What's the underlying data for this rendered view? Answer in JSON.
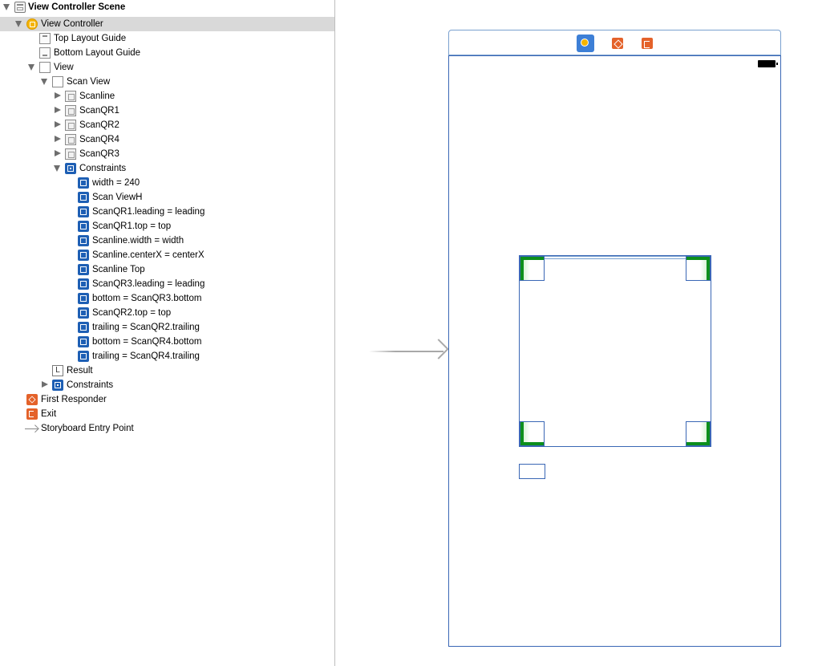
{
  "outline": {
    "items": [
      {
        "label": "View Controller Scene",
        "icon": "scene-icon"
      },
      {
        "label": "View Controller",
        "icon": "view-controller-icon"
      },
      {
        "label": "Top Layout Guide",
        "icon": "top-layout-guide-icon"
      },
      {
        "label": "Bottom Layout Guide",
        "icon": "bottom-layout-guide-icon"
      },
      {
        "label": "View",
        "icon": "view-icon"
      },
      {
        "label": "Scan View",
        "icon": "view-icon"
      },
      {
        "label": "Scanline",
        "icon": "image-view-icon"
      },
      {
        "label": "ScanQR1",
        "icon": "image-view-icon"
      },
      {
        "label": "ScanQR2",
        "icon": "image-view-icon"
      },
      {
        "label": "ScanQR4",
        "icon": "image-view-icon"
      },
      {
        "label": "ScanQR3",
        "icon": "image-view-icon"
      },
      {
        "label": "Constraints",
        "icon": "constraints-icon"
      },
      {
        "label": "width = 240",
        "icon": "constraint-icon"
      },
      {
        "label": "Scan ViewH",
        "icon": "constraint-icon"
      },
      {
        "label": "ScanQR1.leading = leading",
        "icon": "constraint-icon"
      },
      {
        "label": "ScanQR1.top = top",
        "icon": "constraint-icon"
      },
      {
        "label": "Scanline.width = width",
        "icon": "constraint-icon"
      },
      {
        "label": "Scanline.centerX = centerX",
        "icon": "constraint-icon"
      },
      {
        "label": "Scanline Top",
        "icon": "constraint-icon"
      },
      {
        "label": "ScanQR3.leading = leading",
        "icon": "constraint-icon"
      },
      {
        "label": "bottom = ScanQR3.bottom",
        "icon": "constraint-icon"
      },
      {
        "label": "ScanQR2.top = top",
        "icon": "constraint-icon"
      },
      {
        "label": "trailing = ScanQR2.trailing",
        "icon": "constraint-icon"
      },
      {
        "label": "bottom = ScanQR4.bottom",
        "icon": "constraint-icon"
      },
      {
        "label": "trailing = ScanQR4.trailing",
        "icon": "constraint-icon"
      },
      {
        "label": "Result",
        "icon": "label-icon"
      },
      {
        "label": "Constraints",
        "icon": "constraints-icon"
      },
      {
        "label": "First Responder",
        "icon": "first-responder-icon"
      },
      {
        "label": "Exit",
        "icon": "exit-icon"
      },
      {
        "label": "Storyboard Entry Point",
        "icon": "entry-point-arrow-icon"
      }
    ],
    "label_icon_glyph": "L"
  },
  "canvas": {
    "scene_bar_icons": [
      "view-controller-icon",
      "first-responder-icon",
      "exit-icon"
    ],
    "colors": {
      "selection": "#d9d9d9",
      "frame_border": "#3a67b5",
      "corner_green": "#0c8f1c",
      "vc_yellow": "#f5b400",
      "orange": "#e4622a",
      "constraint_blue": "#1e5fb4"
    }
  }
}
